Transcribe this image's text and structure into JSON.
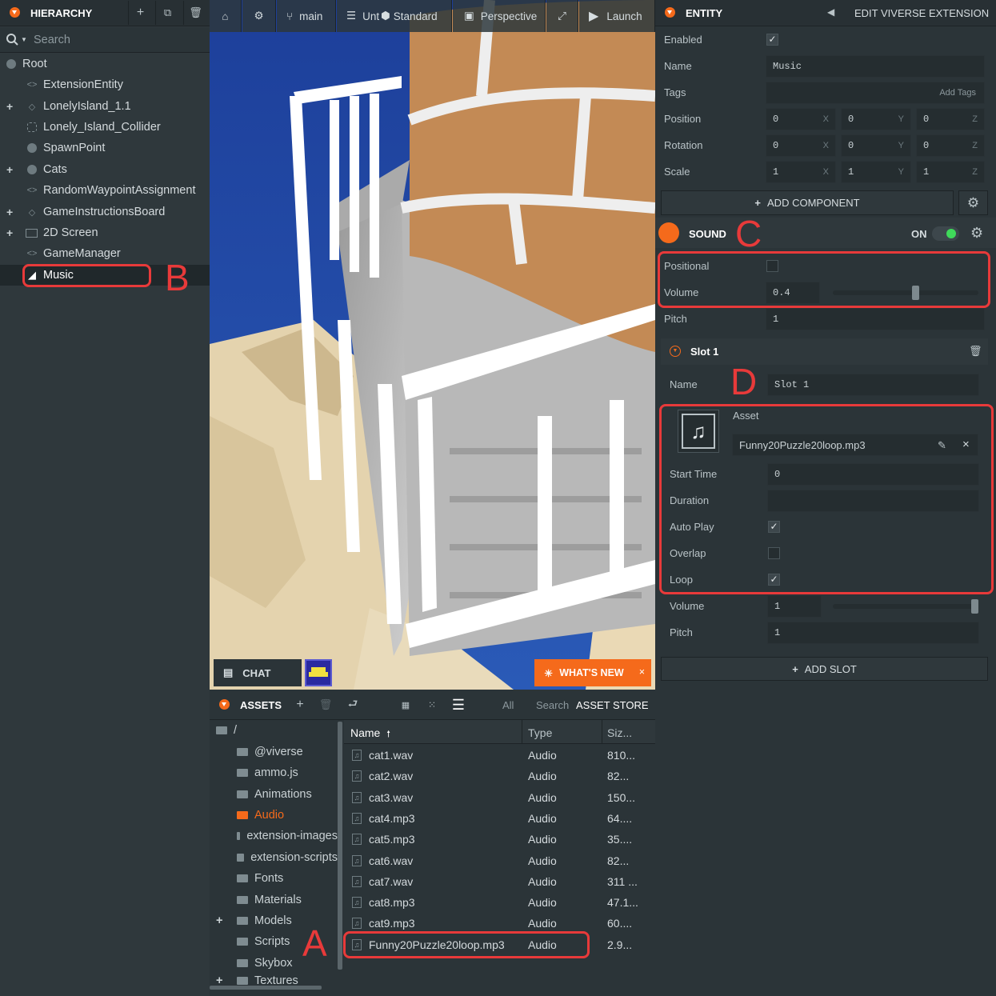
{
  "hierarchy": {
    "title": "HIERARCHY",
    "search_placeholder": "Search",
    "items": [
      {
        "label": "Root",
        "icon": "dot-icon",
        "expandable": false
      },
      {
        "label": "ExtensionEntity",
        "icon": "code-icon",
        "expandable": false
      },
      {
        "label": "LonelyIsland_1.1",
        "icon": "diamond-icon",
        "expandable": true
      },
      {
        "label": "Lonely_Island_Collider",
        "icon": "collider-icon",
        "expandable": false
      },
      {
        "label": "SpawnPoint",
        "icon": "dot-icon",
        "expandable": false
      },
      {
        "label": "Cats",
        "icon": "dot-icon",
        "expandable": true
      },
      {
        "label": "RandomWaypointAssignment",
        "icon": "code-icon",
        "expandable": false
      },
      {
        "label": "GameInstructionsBoard",
        "icon": "diamond-icon",
        "expandable": true
      },
      {
        "label": "2D Screen",
        "icon": "screen-icon",
        "expandable": true
      },
      {
        "label": "GameManager",
        "icon": "code-icon",
        "expandable": false
      },
      {
        "label": "Music",
        "icon": "sound-icon",
        "expandable": false,
        "selected": true
      }
    ]
  },
  "viewport": {
    "toolbar": {
      "branch": "main",
      "scene": "Unt",
      "render_mode": "Standard",
      "camera": "Perspective",
      "launch": "Launch"
    },
    "chat_label": "CHAT",
    "whats_new_label": "WHAT'S NEW"
  },
  "assets": {
    "title": "ASSETS",
    "filter_all": "All",
    "search_placeholder": "Search",
    "asset_store_label": "ASSET STORE",
    "root_label": "/",
    "folders": [
      "@viverse",
      "ammo.js",
      "Animations",
      "Audio",
      "extension-images",
      "extension-scripts",
      "Fonts",
      "Materials",
      "Models",
      "Scripts",
      "Skybox",
      "Textures"
    ],
    "selected_folder": "Audio",
    "columns": {
      "name": "Name",
      "type": "Type",
      "size": "Siz..."
    },
    "rows": [
      {
        "name": "cat1.wav",
        "type": "Audio",
        "size": "810..."
      },
      {
        "name": "cat2.wav",
        "type": "Audio",
        "size": "82..."
      },
      {
        "name": "cat3.wav",
        "type": "Audio",
        "size": "150..."
      },
      {
        "name": "cat4.mp3",
        "type": "Audio",
        "size": "64...."
      },
      {
        "name": "cat5.mp3",
        "type": "Audio",
        "size": "35...."
      },
      {
        "name": "cat6.wav",
        "type": "Audio",
        "size": "82..."
      },
      {
        "name": "cat7.wav",
        "type": "Audio",
        "size": "311 ..."
      },
      {
        "name": "cat8.mp3",
        "type": "Audio",
        "size": "47.1..."
      },
      {
        "name": "cat9.mp3",
        "type": "Audio",
        "size": "60...."
      },
      {
        "name": "Funny20Puzzle20loop.mp3",
        "type": "Audio",
        "size": "2.9..."
      }
    ]
  },
  "entity": {
    "title": "ENTITY",
    "edit_extension_label": "EDIT VIVERSE EXTENSION",
    "enabled_label": "Enabled",
    "enabled": true,
    "name_label": "Name",
    "name_value": "Music",
    "tags_label": "Tags",
    "add_tags_placeholder": "Add Tags",
    "position_label": "Position",
    "position": [
      "0",
      "0",
      "0"
    ],
    "rotation_label": "Rotation",
    "rotation": [
      "0",
      "0",
      "0"
    ],
    "scale_label": "Scale",
    "scale": [
      "1",
      "1",
      "1"
    ],
    "axes": [
      "X",
      "Y",
      "Z"
    ],
    "add_component_label": "ADD COMPONENT"
  },
  "sound": {
    "title": "SOUND",
    "on_label": "ON",
    "positional_label": "Positional",
    "positional": false,
    "volume_label": "Volume",
    "volume_value": "0.4",
    "volume": 0.4,
    "pitch_label": "Pitch",
    "pitch_value": "1"
  },
  "slot": {
    "title": "Slot 1",
    "name_label": "Name",
    "name_value": "Slot 1",
    "asset_label": "Asset",
    "asset_value": "Funny20Puzzle20loop.mp3",
    "start_time_label": "Start Time",
    "start_time_value": "0",
    "duration_label": "Duration",
    "duration_value": "",
    "auto_play_label": "Auto Play",
    "auto_play": true,
    "overlap_label": "Overlap",
    "overlap": false,
    "loop_label": "Loop",
    "loop": true,
    "volume_label": "Volume",
    "volume_value": "1",
    "volume": 1,
    "pitch_label": "Pitch",
    "pitch_value": "1",
    "add_slot_label": "ADD SLOT"
  },
  "annotations": {
    "a": "A",
    "b": "B",
    "c": "C",
    "d": "D"
  },
  "colors": {
    "accent": "#f56a1b",
    "highlight": "#e83a3a",
    "toggle_on": "#3fd95a"
  }
}
